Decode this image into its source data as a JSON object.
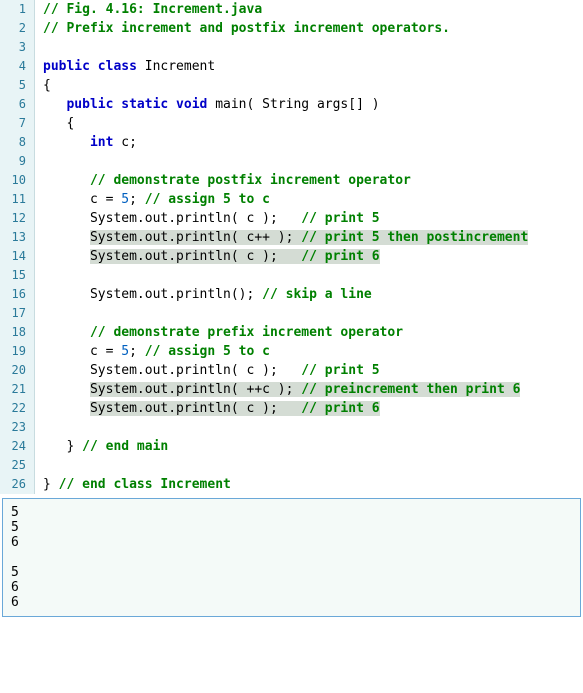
{
  "lines": [
    {
      "n": "1",
      "segs": [
        {
          "t": "// Fig. 4.16: Increment.java",
          "c": "cm"
        }
      ]
    },
    {
      "n": "2",
      "segs": [
        {
          "t": "// Prefix increment and postfix increment operators.",
          "c": "cm"
        }
      ]
    },
    {
      "n": "3",
      "segs": [
        {
          "t": " "
        }
      ]
    },
    {
      "n": "4",
      "segs": [
        {
          "t": "public class",
          "c": "kw"
        },
        {
          "t": " Increment"
        }
      ]
    },
    {
      "n": "5",
      "segs": [
        {
          "t": "{"
        }
      ]
    },
    {
      "n": "6",
      "segs": [
        {
          "t": "   "
        },
        {
          "t": "public static void",
          "c": "kw"
        },
        {
          "t": " main( String args[] )"
        }
      ]
    },
    {
      "n": "7",
      "segs": [
        {
          "t": "   {"
        }
      ]
    },
    {
      "n": "8",
      "segs": [
        {
          "t": "      "
        },
        {
          "t": "int",
          "c": "kw"
        },
        {
          "t": " c;"
        }
      ]
    },
    {
      "n": "9",
      "segs": [
        {
          "t": " "
        }
      ]
    },
    {
      "n": "10",
      "segs": [
        {
          "t": "      "
        },
        {
          "t": "// demonstrate postfix increment operator",
          "c": "cm"
        }
      ]
    },
    {
      "n": "11",
      "segs": [
        {
          "t": "      c = "
        },
        {
          "t": "5",
          "c": "num"
        },
        {
          "t": "; "
        },
        {
          "t": "// assign 5 to c",
          "c": "cm"
        }
      ]
    },
    {
      "n": "12",
      "segs": [
        {
          "t": "      System.out.println( c );   "
        },
        {
          "t": "// print 5",
          "c": "cm"
        }
      ]
    },
    {
      "n": "13",
      "segs": [
        {
          "t": "      "
        },
        {
          "t": "System.out.println( c++ ); ",
          "c": "",
          "hl": true
        },
        {
          "t": "// print 5 then postincrement",
          "c": "cm",
          "hl": true
        }
      ]
    },
    {
      "n": "14",
      "segs": [
        {
          "t": "      "
        },
        {
          "t": "System.out.println( c );   ",
          "c": "",
          "hl": true
        },
        {
          "t": "// print 6",
          "c": "cm",
          "hl": true
        }
      ]
    },
    {
      "n": "15",
      "segs": [
        {
          "t": " "
        }
      ]
    },
    {
      "n": "16",
      "segs": [
        {
          "t": "      System.out.println(); "
        },
        {
          "t": "// skip a line",
          "c": "cm"
        }
      ]
    },
    {
      "n": "17",
      "segs": [
        {
          "t": " "
        }
      ]
    },
    {
      "n": "18",
      "segs": [
        {
          "t": "      "
        },
        {
          "t": "// demonstrate prefix increment operator",
          "c": "cm"
        }
      ]
    },
    {
      "n": "19",
      "segs": [
        {
          "t": "      c = "
        },
        {
          "t": "5",
          "c": "num"
        },
        {
          "t": "; "
        },
        {
          "t": "// assign 5 to c",
          "c": "cm"
        }
      ]
    },
    {
      "n": "20",
      "segs": [
        {
          "t": "      System.out.println( c );   "
        },
        {
          "t": "// print 5",
          "c": "cm"
        }
      ]
    },
    {
      "n": "21",
      "segs": [
        {
          "t": "      "
        },
        {
          "t": "System.out.println( ++c ); ",
          "c": "",
          "hl": true
        },
        {
          "t": "// preincrement then print 6",
          "c": "cm",
          "hl": true
        }
      ]
    },
    {
      "n": "22",
      "segs": [
        {
          "t": "      "
        },
        {
          "t": "System.out.println( c );   ",
          "c": "",
          "hl": true
        },
        {
          "t": "// print 6",
          "c": "cm",
          "hl": true
        }
      ]
    },
    {
      "n": "23",
      "segs": [
        {
          "t": " "
        }
      ]
    },
    {
      "n": "24",
      "segs": [
        {
          "t": "   } "
        },
        {
          "t": "// end main",
          "c": "cm"
        }
      ]
    },
    {
      "n": "25",
      "segs": [
        {
          "t": " "
        }
      ]
    },
    {
      "n": "26",
      "segs": [
        {
          "t": "} "
        },
        {
          "t": "// end class Increment",
          "c": "cm"
        }
      ]
    }
  ],
  "output": "5\n5\n6\n\n5\n6\n6"
}
